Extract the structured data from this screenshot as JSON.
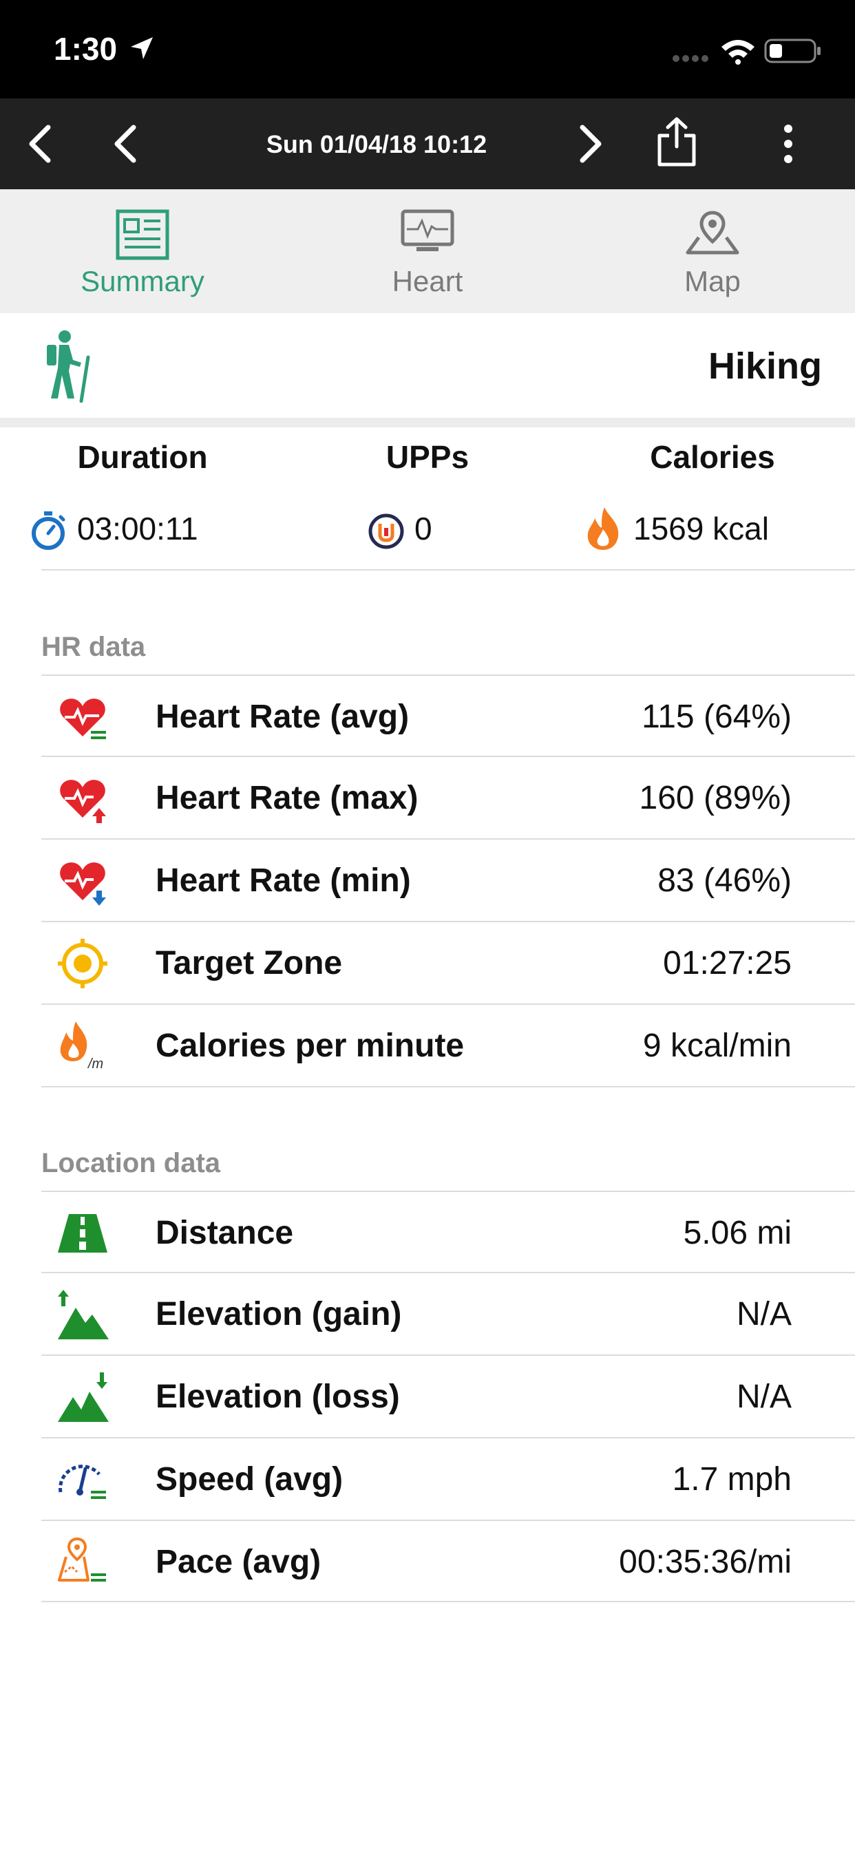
{
  "status_bar": {
    "time": "1:30",
    "location_icon": "location-arrow-icon",
    "signal_icon": "cellular-signal-icon",
    "wifi_icon": "wifi-icon",
    "battery_icon": "battery-icon"
  },
  "nav": {
    "title": "Sun 01/04/18 10:12",
    "back_icon": "chevron-left-icon",
    "prev_icon": "chevron-left-icon",
    "next_icon": "chevron-right-icon",
    "share_icon": "share-icon",
    "more_icon": "more-vertical-icon"
  },
  "tabs": [
    {
      "label": "Summary",
      "active": true,
      "icon": "summary-icon"
    },
    {
      "label": "Heart",
      "active": false,
      "icon": "heart-monitor-icon"
    },
    {
      "label": "Map",
      "active": false,
      "icon": "map-icon"
    }
  ],
  "activity": {
    "name": "Hiking",
    "icon": "hiker-icon"
  },
  "summary": {
    "duration": {
      "header": "Duration",
      "value": "03:00:11",
      "icon": "stopwatch-icon"
    },
    "upps": {
      "header": "UPPs",
      "value": "0",
      "icon": "upps-icon"
    },
    "calories": {
      "header": "Calories",
      "value": "1569 kcal",
      "icon": "flame-icon"
    }
  },
  "hr_section": {
    "title": "HR data",
    "rows": [
      {
        "label": "Heart Rate (avg)",
        "value": "115 (64%)",
        "icon": "heart-rate-avg-icon"
      },
      {
        "label": "Heart Rate (max)",
        "value": "160 (89%)",
        "icon": "heart-rate-max-icon"
      },
      {
        "label": "Heart Rate (min)",
        "value": "83 (46%)",
        "icon": "heart-rate-min-icon"
      },
      {
        "label": "Target Zone",
        "value": "01:27:25",
        "icon": "target-zone-icon"
      },
      {
        "label": "Calories per minute",
        "value": "9 kcal/min",
        "icon": "calories-per-minute-icon"
      }
    ]
  },
  "location_section": {
    "title": "Location data",
    "rows": [
      {
        "label": "Distance",
        "value": "5.06 mi",
        "icon": "distance-road-icon"
      },
      {
        "label": "Elevation (gain)",
        "value": "N/A",
        "icon": "elevation-gain-icon"
      },
      {
        "label": "Elevation (loss)",
        "value": "N/A",
        "icon": "elevation-loss-icon"
      },
      {
        "label": "Speed (avg)",
        "value": "1.7 mph",
        "icon": "speedometer-icon"
      },
      {
        "label": "Pace (avg)",
        "value": "00:35:36/mi",
        "icon": "pace-map-icon"
      }
    ]
  },
  "colors": {
    "accent_green": "#2e9e7a",
    "heart_red": "#e3262c",
    "flame_orange": "#f57c1f",
    "target_yellow": "#f7b600",
    "location_green": "#1f8f2e",
    "header_dark": "#212121"
  }
}
